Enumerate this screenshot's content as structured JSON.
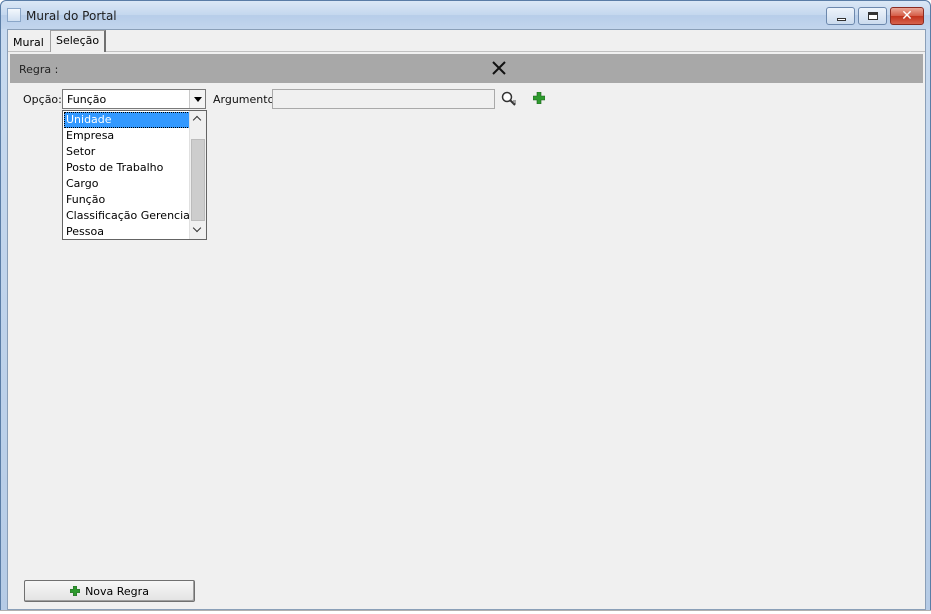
{
  "window": {
    "title": "Mural do Portal",
    "close_glyph": "✕"
  },
  "tabs": [
    {
      "label": "Mural"
    },
    {
      "label": "Seleção"
    }
  ],
  "rule": {
    "label": "Regra :"
  },
  "filter": {
    "option_label": "Opção:",
    "option_value": "Função",
    "argument_label": "Argumento:",
    "argument_value": ""
  },
  "dropdown": {
    "items": [
      "Unidade",
      "Empresa",
      "Setor",
      "Posto de Trabalho",
      "Cargo",
      "Função",
      "Classificação Gerencial",
      "Pessoa"
    ],
    "selected": "Unidade"
  },
  "footer": {
    "new_rule_label": "Nova Regra"
  },
  "colors": {
    "selection": "#3399ff",
    "rule_bar": "#a8a8a8",
    "plus_green": "#2e9a2e"
  }
}
